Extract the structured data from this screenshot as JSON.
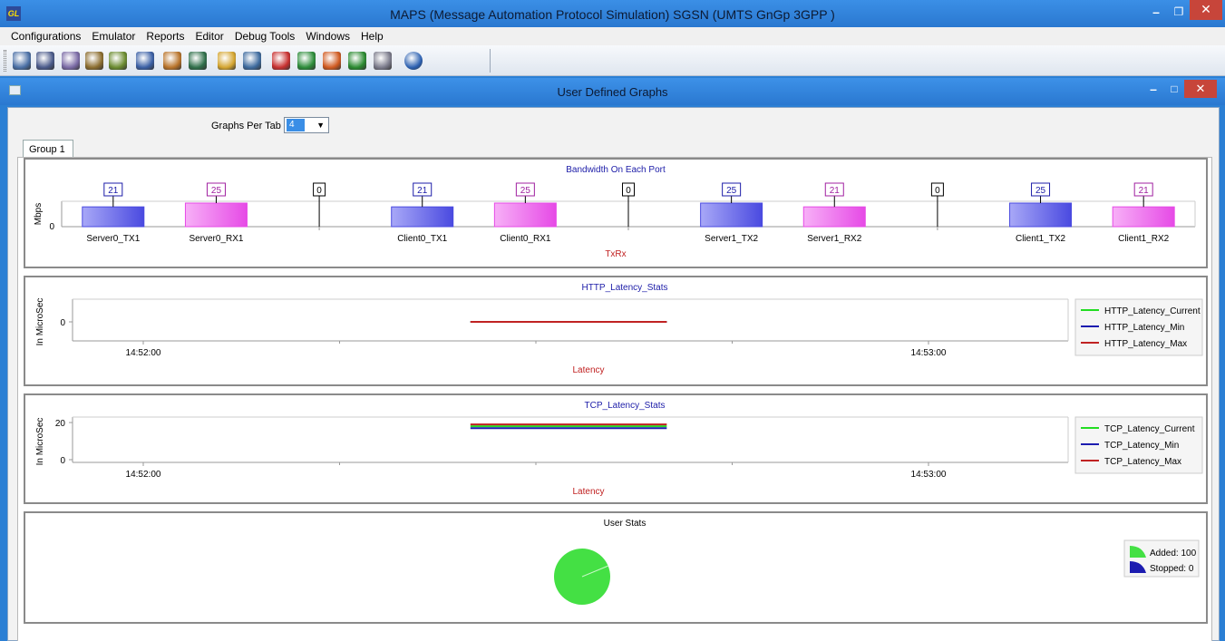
{
  "app": {
    "icon_text": "GL",
    "title": "MAPS (Message Automation Protocol Simulation) SGSN (UMTS GnGp 3GPP )"
  },
  "menu": [
    "Configurations",
    "Emulator",
    "Reports",
    "Editor",
    "Debug Tools",
    "Windows",
    "Help"
  ],
  "toolbar": {
    "icons": [
      "gear-icon",
      "notepad-icon",
      "edit-script-icon",
      "arrows-icon",
      "users-icon",
      "blocks-icon",
      "briefcase-icon",
      "phone-icon",
      "pencil-check-icon",
      "satellite-icon",
      "stop-icon",
      "capture-icon",
      "pause-icon",
      "exchange-icon",
      "equipment-icon",
      "help-icon"
    ],
    "colors": [
      "#4a6fa5",
      "#4a5a8a",
      "#7a6aa5",
      "#8b6d2f",
      "#6a8b2f",
      "#3a5fa5",
      "#b8732a",
      "#2f6f4a",
      "#d4a530",
      "#3d6a9e",
      "#c83030",
      "#2c8c3a",
      "#d05a20",
      "#2a8a30",
      "#7a7a8a",
      "#2a5fb0"
    ]
  },
  "child_window": {
    "title": "User Defined Graphs"
  },
  "graphs_per_tab": {
    "label": "Graphs Per Tab",
    "value": "4"
  },
  "tabs": [
    "Group 1"
  ],
  "colors": {
    "bar_blue": "#4a4ae0",
    "bar_pink": "#e64ae6",
    "title_blue": "#1c1ca8",
    "axis_red": "#c02020",
    "current_green": "#22dd22",
    "min_blue": "#1c1cb0",
    "max_red": "#c02222",
    "pie_green": "#44e044"
  },
  "chart_data": [
    {
      "type": "bar",
      "title": "Bandwidth On Each Port",
      "ylabel": "Mbps",
      "xlabel": "TxRx",
      "y_ticks": [
        "0"
      ],
      "categories": [
        "Server0_TX1",
        "Server0_RX1",
        "",
        "Client0_TX1",
        "Client0_RX1",
        "",
        "Server1_TX2",
        "Server1_RX2",
        "",
        "Client1_TX2",
        "Client1_RX2"
      ],
      "values": [
        21,
        25,
        0,
        21,
        25,
        0,
        25,
        21,
        0,
        25,
        21
      ],
      "bar_colors": [
        "blue",
        "pink",
        "",
        "blue",
        "pink",
        "",
        "blue",
        "pink",
        "",
        "blue",
        "pink"
      ],
      "grid": false
    },
    {
      "type": "line",
      "title": "HTTP_Latency_Stats",
      "ylabel": "In MicroSec",
      "xlabel": "Latency",
      "y_ticks": [
        "0"
      ],
      "x_ticks": [
        "14:52:00",
        "14:53:00"
      ],
      "series": [
        {
          "name": "HTTP_Latency_Current",
          "color": "current_green",
          "from": "14:52:25",
          "to": "14:52:40",
          "value": 0
        },
        {
          "name": "HTTP_Latency_Min",
          "color": "min_blue",
          "from": "14:52:25",
          "to": "14:52:40",
          "value": 0
        },
        {
          "name": "HTTP_Latency_Max",
          "color": "max_red",
          "from": "14:52:25",
          "to": "14:52:40",
          "value": 0
        }
      ],
      "legend": "right"
    },
    {
      "type": "line",
      "title": "TCP_Latency_Stats",
      "ylabel": "In MicroSec",
      "xlabel": "Latency",
      "y_ticks": [
        "20",
        "0"
      ],
      "ylim": [
        0,
        21
      ],
      "x_ticks": [
        "14:52:00",
        "14:53:00"
      ],
      "series": [
        {
          "name": "TCP_Latency_Current",
          "color": "current_green",
          "from": "14:52:25",
          "to": "14:52:40",
          "value": 18
        },
        {
          "name": "TCP_Latency_Min",
          "color": "min_blue",
          "from": "14:52:25",
          "to": "14:52:40",
          "value": 17
        },
        {
          "name": "TCP_Latency_Max",
          "color": "max_red",
          "from": "14:52:25",
          "to": "14:52:40",
          "value": 19
        }
      ],
      "legend": "right"
    },
    {
      "type": "pie",
      "title": "User Stats",
      "slices": [
        {
          "name": "Added: 100",
          "value": 100,
          "color": "pie_green"
        },
        {
          "name": "Stopped: 0",
          "value": 0,
          "color": "min_blue"
        }
      ],
      "legend": "right"
    }
  ]
}
